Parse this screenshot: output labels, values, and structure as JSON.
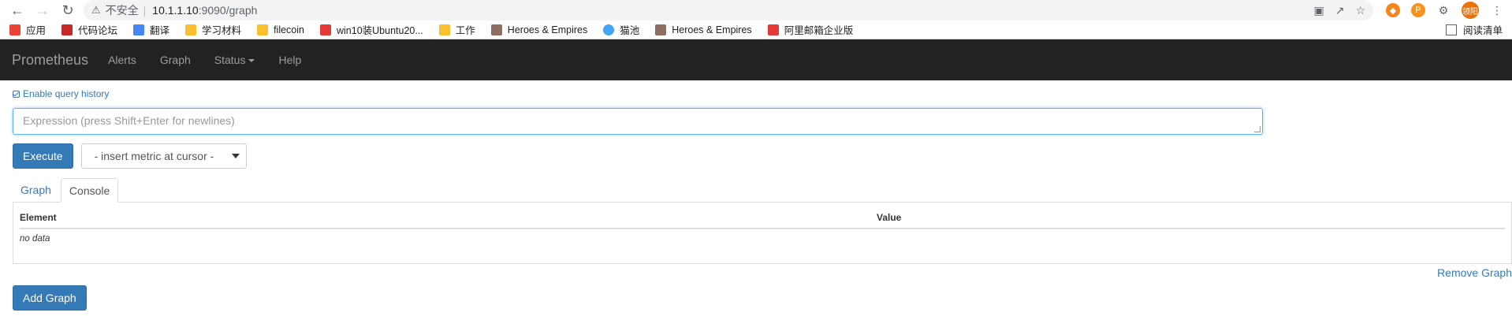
{
  "browser": {
    "security_label": "不安全",
    "url_host": "10.1.1.10",
    "url_path": ":9090/graph",
    "avatar_text": "领阳"
  },
  "bookmarks": [
    {
      "label": "应用",
      "color": "#ea4335"
    },
    {
      "label": "代码论坛",
      "color": "#c62828"
    },
    {
      "label": "翻译",
      "color": "#4285f4"
    },
    {
      "label": "学习材料",
      "color": "#fbc02d"
    },
    {
      "label": "filecoin",
      "color": "#fbc02d"
    },
    {
      "label": "win10装Ubuntu20...",
      "color": "#e53935"
    },
    {
      "label": "工作",
      "color": "#fbc02d"
    },
    {
      "label": "Heroes & Empires",
      "color": "#8d6e63"
    },
    {
      "label": "猫池",
      "color": "#42a5f5"
    },
    {
      "label": "Heroes & Empires",
      "color": "#8d6e63"
    },
    {
      "label": "阿里邮箱企业版",
      "color": "#e53935"
    }
  ],
  "reading_list": "阅读清单",
  "navbar": {
    "brand": "Prometheus",
    "alerts": "Alerts",
    "graph": "Graph",
    "status": "Status",
    "help": "Help"
  },
  "query_history_label": "Enable query history",
  "expression_placeholder": "Expression (press Shift+Enter for newlines)",
  "execute_label": "Execute",
  "metric_select": "- insert metric at cursor -",
  "tabs": {
    "graph": "Graph",
    "console": "Console"
  },
  "table": {
    "col_element": "Element",
    "col_value": "Value",
    "empty": "no data"
  },
  "remove_graph": "Remove Graph",
  "add_graph": "Add Graph",
  "colors": {
    "accent": "#337ab7",
    "navbar_bg": "#222222"
  }
}
